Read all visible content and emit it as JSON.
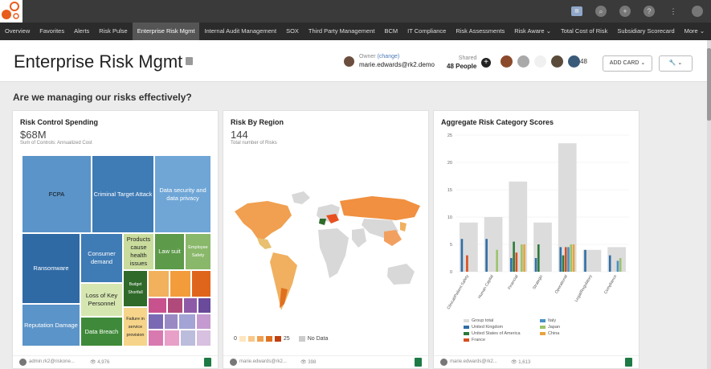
{
  "topbar": {
    "icons": [
      "app-grid-icon",
      "search-icon",
      "add-circle-icon",
      "help-icon",
      "apps-icon",
      "user-icon"
    ]
  },
  "nav": {
    "items": [
      "Overview",
      "Favorites",
      "Alerts",
      "Risk Pulse",
      "Enterprise Risk Mgmt",
      "Internal Audit Management",
      "SOX",
      "Third Party Management",
      "BCM",
      "IT Compliance",
      "Risk Assessments",
      "Risk Aware",
      "Total Cost of Risk",
      "Subsidiary Scorecard",
      "More"
    ],
    "active": "Enterprise Risk Mgmt"
  },
  "header": {
    "title": "Enterprise Risk Mgmt",
    "owner_label": "Owner",
    "owner_change": "(change)",
    "owner_email": "marie.edwards@rk2.demo",
    "shared_label": "Shared",
    "shared_count": "48 People",
    "avatar_count": "48",
    "add_card": "ADD CARD",
    "colors": {
      "accent": "#f39c12"
    }
  },
  "question": "Are we managing our risks effectively?",
  "cards": {
    "spending": {
      "title": "Risk Control Spending",
      "value": "$68M",
      "subtitle": "Sum of Controls: Annualized Cost",
      "treemap": [
        "FCPA",
        "Criminal Target Attack",
        "Data security and data privacy",
        "Ransomware",
        "Consumer demand",
        "Products cause health issues",
        "Law suit",
        "Employee Safety",
        "Loss of Key Personnel",
        "Budget Shortfall",
        "Reputation Damage",
        "Data Breach",
        "Failure in service provision"
      ],
      "footer_user": "admin.rk2@riskone...",
      "footer_views": "4,976"
    },
    "region": {
      "title": "Risk By Region",
      "value": "144",
      "subtitle": "Total number of Risks",
      "legend_min": "0",
      "legend_max": "25",
      "legend_nodata": "No Data",
      "footer_user": "marie.edwards@rk2...",
      "footer_views": "398"
    },
    "aggregate": {
      "title": "Aggregate Risk Category Scores",
      "footer_user": "marie.edwards@rk2...",
      "footer_views": "1,613"
    }
  },
  "chart_data": {
    "type": "bar",
    "title": "Aggregate Risk Category Scores",
    "categories": [
      "Clinical/Patient Safety",
      "Human Capital",
      "Financial",
      "Strategic",
      "Operational",
      "Legal/Regulatory",
      "Compliance"
    ],
    "ylim": [
      0,
      25
    ],
    "yticks": [
      0,
      5,
      10,
      15,
      20,
      25
    ],
    "series": [
      {
        "name": "Group total",
        "color": "#dcdcdc",
        "values": [
          9,
          10,
          16.5,
          9,
          23.5,
          4,
          4.5
        ]
      },
      {
        "name": "United Kingdom",
        "color": "#2e6ea6",
        "values": [
          6,
          6,
          2.5,
          2.5,
          4.5,
          4,
          3
        ]
      },
      {
        "name": "United States of America",
        "color": "#2c7a3a",
        "values": [
          0,
          0,
          5.5,
          5,
          3,
          0,
          0
        ]
      },
      {
        "name": "France",
        "color": "#d94e1f",
        "values": [
          3,
          0,
          3.5,
          0,
          4.5,
          0,
          0
        ]
      },
      {
        "name": "Italy",
        "color": "#4a90c8",
        "values": [
          0,
          0,
          0,
          0,
          4.5,
          0,
          2
        ]
      },
      {
        "name": "Japan",
        "color": "#9bc36b",
        "values": [
          0,
          4,
          5,
          0,
          5,
          0,
          2.5
        ]
      },
      {
        "name": "China",
        "color": "#e8a33c",
        "values": [
          0,
          0,
          5,
          0,
          5,
          0,
          0
        ]
      }
    ],
    "legend_position": "bottom"
  }
}
